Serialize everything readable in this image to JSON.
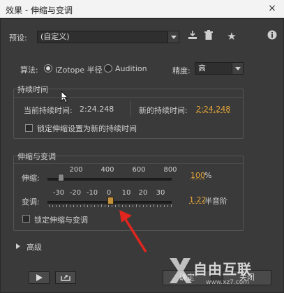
{
  "window": {
    "title": "效果 - 伸缩与变调",
    "close_symbol": "×"
  },
  "preset": {
    "label": "预设:",
    "value": "(自定义)"
  },
  "algorithm": {
    "label": "算法:",
    "options": [
      {
        "label": "iZotope 半径",
        "selected": true
      },
      {
        "label": "Audition",
        "selected": false
      }
    ],
    "precision_label": "精度:",
    "precision_value": "高"
  },
  "duration": {
    "title": "持续时间",
    "current_label": "当前持续时间:",
    "current_value": "2:24.248",
    "new_label": "新的持续时间:",
    "new_value": "2:24.248",
    "lock_label": "锁定伸缩设置为新的持续时间"
  },
  "stretch_pitch": {
    "title": "伸缩与变调",
    "stretch_label": "伸缩:",
    "stretch_ticks": [
      "200",
      "400",
      "600",
      "800"
    ],
    "stretch_value": "100",
    "stretch_unit": "%",
    "stretch_level_percent": 100,
    "pitch_label": "变调:",
    "pitch_ticks": [
      "-30",
      "-20",
      "-10",
      "0",
      "10",
      "20",
      "30"
    ],
    "pitch_value": "1.22",
    "pitch_unit": "半音阶",
    "lock_label": "锁定伸缩与变调"
  },
  "advanced": {
    "label": "高级"
  },
  "buttons": {
    "ok": "确定",
    "close": "关闭"
  },
  "watermark": {
    "text": "自由互联",
    "url": "www.xz7.com"
  },
  "colors": {
    "accent_orange": "#e7a73a",
    "panel_bg": "#3a3a3a"
  }
}
